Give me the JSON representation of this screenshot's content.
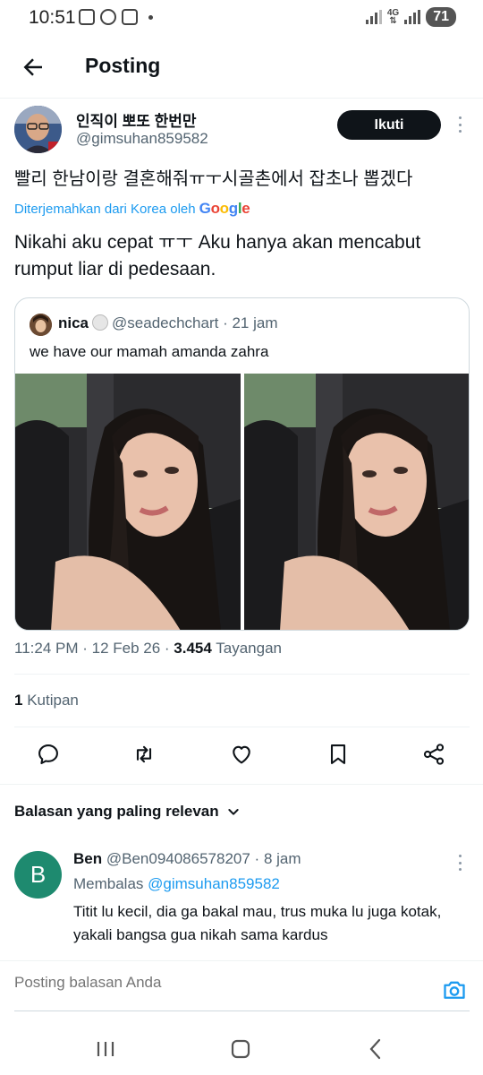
{
  "status_bar": {
    "time": "10:51",
    "network": "4G",
    "battery": "71"
  },
  "header": {
    "title": "Posting"
  },
  "tweet": {
    "author_name": "인직이 뽀또 한번만",
    "author_handle": "@gimsuhan859582",
    "follow_label": "Ikuti",
    "text_original": "빨리 한남이랑 결혼해줘ㅠㅜ시골촌에서 잡초나 뽑겠다",
    "translated_label": "Diterjemahkan dari Korea oleh",
    "translator_brand": "Google",
    "text_translated": "Nikahi aku cepat ㅠㅜ Aku hanya akan mencabut rumput liar di pedesaan.",
    "quote": {
      "name": "nica",
      "handle": "@seadechchart",
      "time": "21 jam",
      "text": "we have our mamah amanda zahra"
    },
    "time": "11:24 PM",
    "date": "12 Feb 26",
    "views_count": "3.454",
    "views_label": "Tayangan",
    "quotes_count": "1",
    "quotes_label": "Kutipan"
  },
  "replies_filter": {
    "label": "Balasan yang paling relevan"
  },
  "reply": {
    "avatar_letter": "B",
    "name": "Ben",
    "handle": "@Ben094086578207",
    "time": "8 jam",
    "replying_label": "Membalas",
    "replying_to": "@gimsuhan859582",
    "text": "Titit lu kecil, dia ga bakal mau, trus muka lu juga kotak, yakali bangsa gua nikah sama kardus"
  },
  "compose": {
    "placeholder": "Posting balasan Anda"
  },
  "colors": {
    "accent": "#1d9bf0",
    "text": "#0f1419",
    "secondary": "#536471",
    "reply_avatar": "#1e8a6f"
  }
}
